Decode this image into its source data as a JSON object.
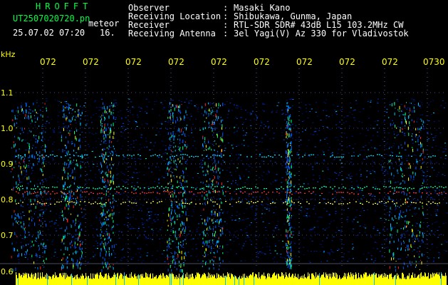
{
  "header": {
    "brand": "HROFFT",
    "filename": "UT2507020720.pn",
    "datetime": "25.07.02 07:20",
    "meteor_label": "meteor",
    "duration": "16.",
    "info": [
      {
        "label": "Observer",
        "value": "Masaki Kano"
      },
      {
        "label": "Receiving Location",
        "value": "Shibukawa, Gunma, Japan"
      },
      {
        "label": "Receiver",
        "value": "RTL-SDR SDR# 43dB L15 103.2MHz CW"
      },
      {
        "label": "Receiving Antenna",
        "value": "3el Yagi(V) Az 330 for Vladivostok"
      }
    ],
    "separator": ":"
  },
  "spectrogram": {
    "unit": "kHz",
    "time_labels": [
      "072",
      "072",
      "072",
      "072",
      "072",
      "072",
      "072",
      "072",
      "072",
      "0730"
    ],
    "freq_labels": [
      "1.1",
      "1.0",
      "0.9",
      "0.8",
      "0.7",
      "0.6"
    ],
    "colors": {
      "label": "#ffff00",
      "grid": "#8899ff",
      "baseline": "#ffff00",
      "background": "#000000"
    }
  }
}
